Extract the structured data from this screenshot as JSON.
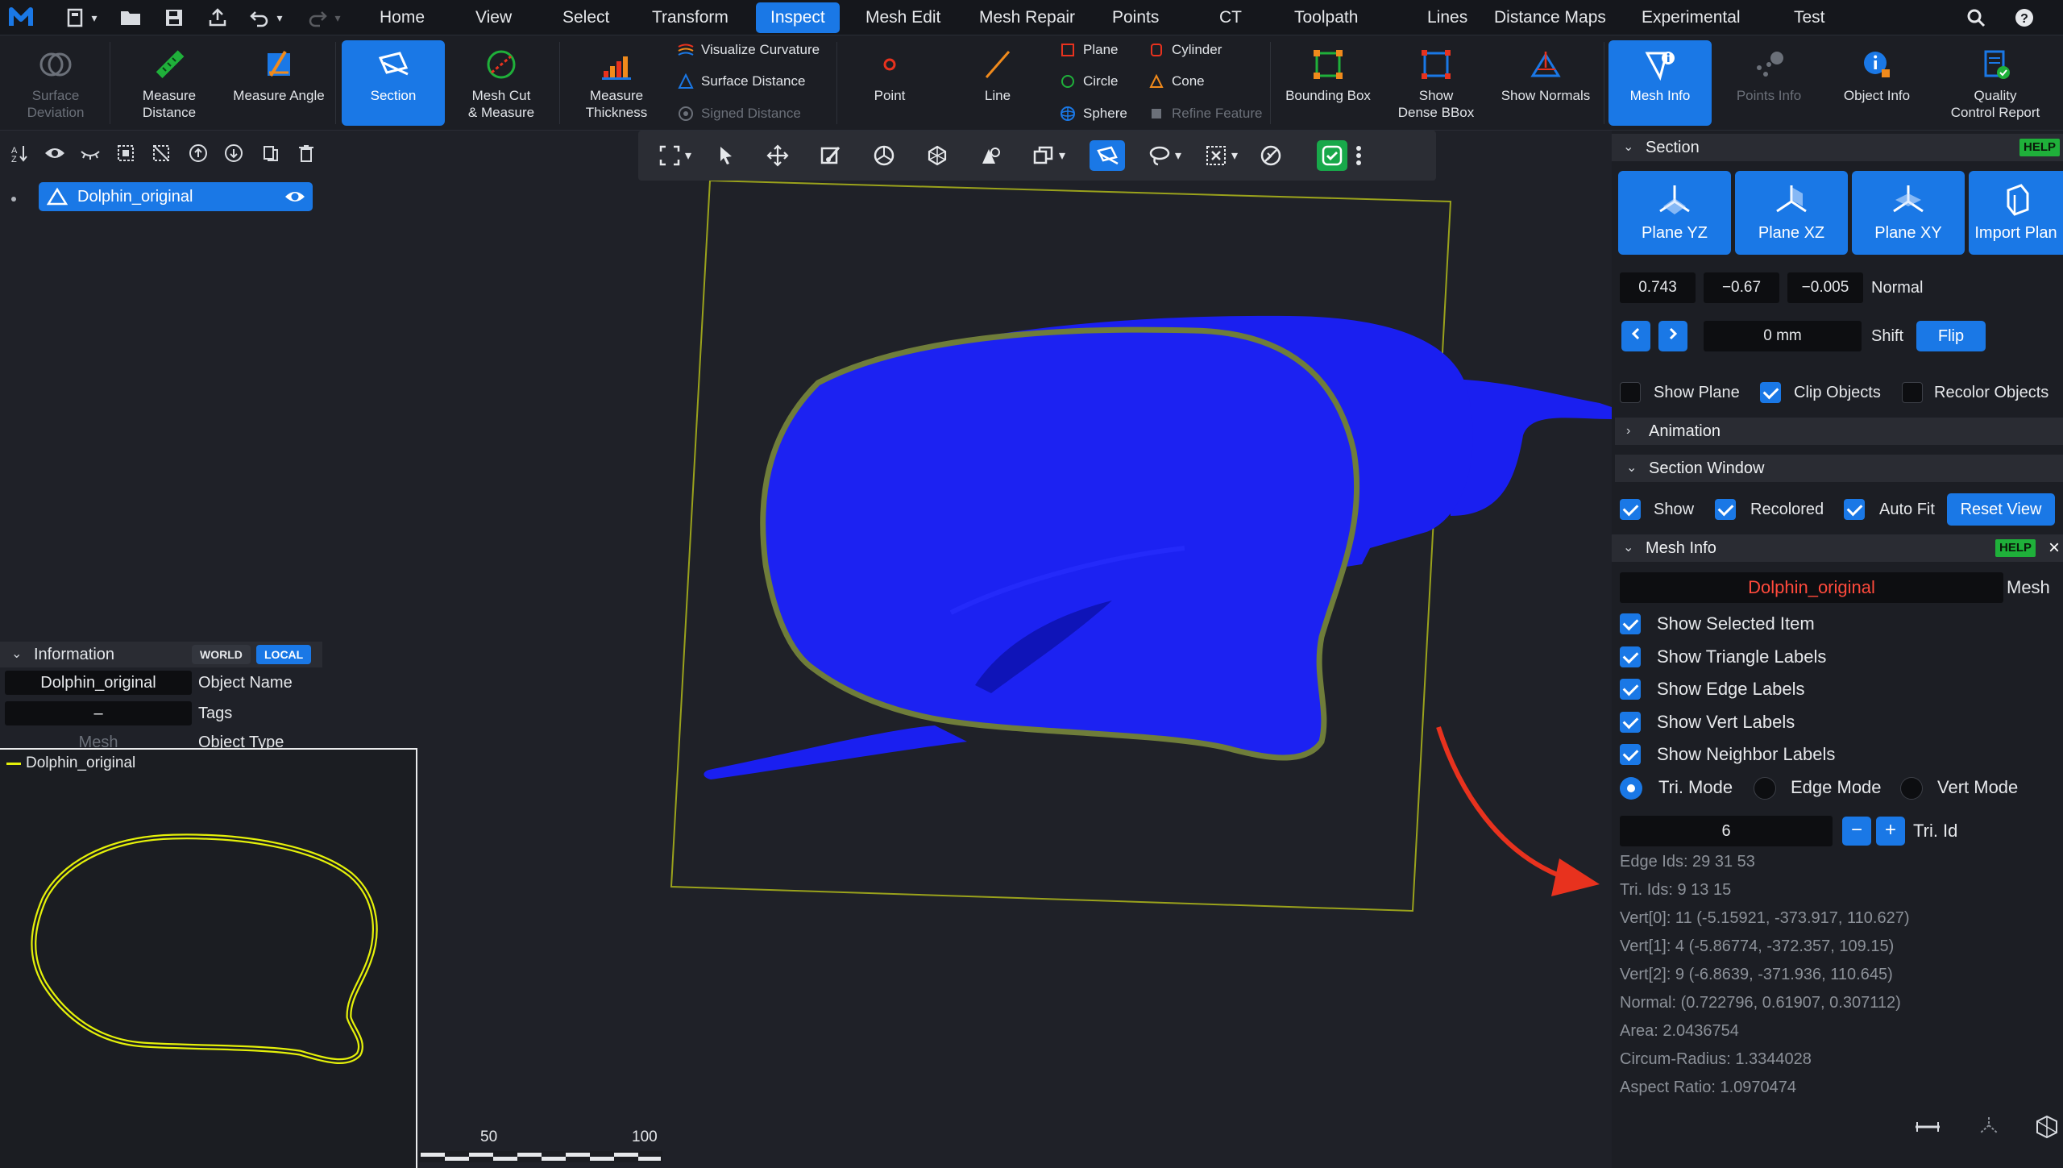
{
  "menu": {
    "tabs": [
      "Home",
      "View",
      "Select",
      "Transform",
      "Inspect",
      "Mesh Edit",
      "Mesh Repair",
      "Points",
      "CT",
      "Toolpath",
      "Lines",
      "Distance Maps",
      "Experimental",
      "Test"
    ],
    "active_tab": "Inspect"
  },
  "ribbon": {
    "surface_deviation": "Surface\nDeviation",
    "measure_distance": "Measure\nDistance",
    "measure_angle": "Measure Angle",
    "section": "Section",
    "mesh_cut_measure": "Mesh Cut\n& Measure",
    "measure_thickness": "Measure\nThickness",
    "visualize_curvature": "Visualize Curvature",
    "surface_distance": "Surface Distance",
    "signed_distance": "Signed Distance",
    "point": "Point",
    "line": "Line",
    "plane": "Plane",
    "circle": "Circle",
    "sphere": "Sphere",
    "cylinder": "Cylinder",
    "cone": "Cone",
    "refine_feature": "Refine Feature",
    "bounding_box": "Bounding Box",
    "show_dense_bbox": "Show\nDense BBox",
    "show_normals": "Show Normals",
    "mesh_info": "Mesh Info",
    "points_info": "Points Info",
    "object_info": "Object Info",
    "quality_control_report": "Quality\nControl Report"
  },
  "scene": {
    "object_name": "Dolphin_original"
  },
  "information": {
    "title": "Information",
    "world": "WORLD",
    "local": "LOCAL",
    "object_name_value": "Dolphin_original",
    "object_name_label": "Object Name",
    "tags_value": "–",
    "tags_label": "Tags",
    "type_value": "Mesh",
    "type_label": "Object Type"
  },
  "section_window": {
    "legend": "Dolphin_original",
    "scale_labels": [
      "50",
      "100"
    ]
  },
  "section_panel": {
    "title": "Section",
    "help": "HELP",
    "plane_buttons": [
      "Plane YZ",
      "Plane XZ",
      "Plane XY",
      "Import Plan"
    ],
    "normal": [
      "0.743",
      "−0.67",
      "−0.005"
    ],
    "normal_label": "Normal",
    "shift_value": "0 mm",
    "shift_label": "Shift",
    "flip": "Flip",
    "show_plane": "Show Plane",
    "clip_objects": "Clip Objects",
    "recolor_objects": "Recolor Objects",
    "show_plane_checked": false,
    "clip_objects_checked": true,
    "recolor_objects_checked": false,
    "animation": "Animation",
    "section_window": "Section Window",
    "show": "Show",
    "recolored": "Recolored",
    "auto_fit": "Auto Fit",
    "reset_view": "Reset View"
  },
  "mesh_info": {
    "title": "Mesh Info",
    "help": "HELP",
    "close": "×",
    "object": "Dolphin_original",
    "object_label": "Mesh",
    "checkboxes": [
      "Show Selected Item",
      "Show Triangle Labels",
      "Show Edge Labels",
      "Show Vert Labels",
      "Show Neighbor Labels"
    ],
    "modes": [
      "Tri. Mode",
      "Edge Mode",
      "Vert Mode"
    ],
    "selected_mode": "Tri. Mode",
    "tri_id_value": "6",
    "tri_id_label": "Tri. Id",
    "details": [
      "Edge Ids: 29 31 53",
      "Tri. Ids: 9 13 15",
      "Vert[0]: 11 (-5.15921, -373.917, 110.627)",
      "Vert[1]: 4 (-5.86774, -372.357, 109.15)",
      "Vert[2]: 9 (-6.8639, -371.936, 110.645)",
      "Normal: (0.722796, 0.61907, 0.307112)",
      "Area: 2.0436754",
      "Circum-Radius: 1.3344028",
      "Aspect Ratio: 1.0970474"
    ]
  },
  "colors": {
    "accent": "#1a78e6",
    "mesh": "#1a1ff0",
    "section_contour": "#6f7d3a",
    "section_2d": "#e4f00a",
    "arrow": "#e8321e",
    "help_badge": "#1fb03a"
  }
}
